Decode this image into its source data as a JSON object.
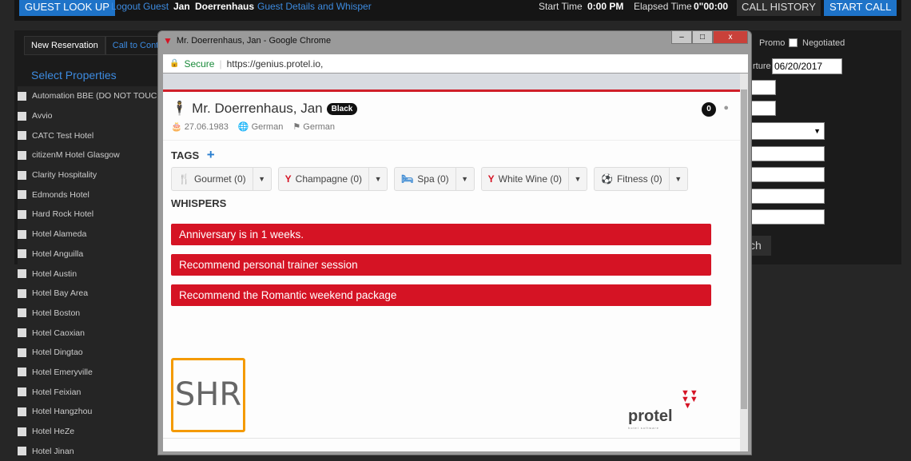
{
  "topbar": {
    "guest_lookup": "GUEST LOOK UP",
    "logout": "Logout Guest",
    "first": "Jan",
    "last": "Doerrenhaus",
    "details": "Guest Details and Whisper",
    "start_label": "Start Time",
    "start_value": "0:00 PM",
    "elapsed_label": "Elapsed Time",
    "elapsed_value": "0\"00:00",
    "call_history": "CALL HISTORY",
    "start_call": "START CALL"
  },
  "tabs": [
    "New Reservation",
    "Call to Cont"
  ],
  "select_properties": "Select Properties",
  "properties": [
    "Automation BBE (DO NOT TOUC",
    "Avvio",
    "CATC Test Hotel",
    "citizenM Hotel Glasgow",
    "Clarity Hospitality",
    "Edmonds Hotel",
    "Hard Rock Hotel",
    "Hotel Alameda",
    "Hotel Anguilla",
    "Hotel Austin",
    "Hotel Bay Area",
    "Hotel Boston",
    "Hotel Caoxian",
    "Hotel Dingtao",
    "Hotel Emeryville",
    "Hotel Feixian",
    "Hotel Hangzhou",
    "Hotel HeZe",
    "Hotel Jinan"
  ],
  "right": {
    "promo": "Promo",
    "negotiated": "Negotiated",
    "departure_label": "rture",
    "departure": "06/20/2017",
    "search": "ch"
  },
  "window": {
    "title": "Mr. Doerrenhaus, Jan - Google Chrome",
    "secure": "Secure",
    "url": "https://genius.protel.io,"
  },
  "guest": {
    "name": "Mr. Doerrenhaus, Jan",
    "tier": "Black",
    "dob": "27.06.1983",
    "nationality": "German",
    "language": "German",
    "count": "0"
  },
  "tags_title": "TAGS",
  "tags": [
    {
      "label": "Gourmet (0)",
      "icon": "utensils"
    },
    {
      "label": "Champagne (0)",
      "icon": "glass"
    },
    {
      "label": "Spa (0)",
      "icon": "bed"
    },
    {
      "label": "White Wine (0)",
      "icon": "glass"
    },
    {
      "label": "Fitness (0)",
      "icon": "ball"
    }
  ],
  "whispers_title": "WHISPERS",
  "whispers": [
    "Anniversary is in 1 weeks.",
    "Recommend personal trainer session",
    "Recommend the Romantic weekend package"
  ],
  "logos": {
    "shr": "SHR",
    "protel": "protel",
    "protel_sub": "hotel software"
  },
  "colors": {
    "accent_blue": "#1e73c8",
    "whisper_red": "#d51324",
    "shr_orange": "#f49a00"
  }
}
